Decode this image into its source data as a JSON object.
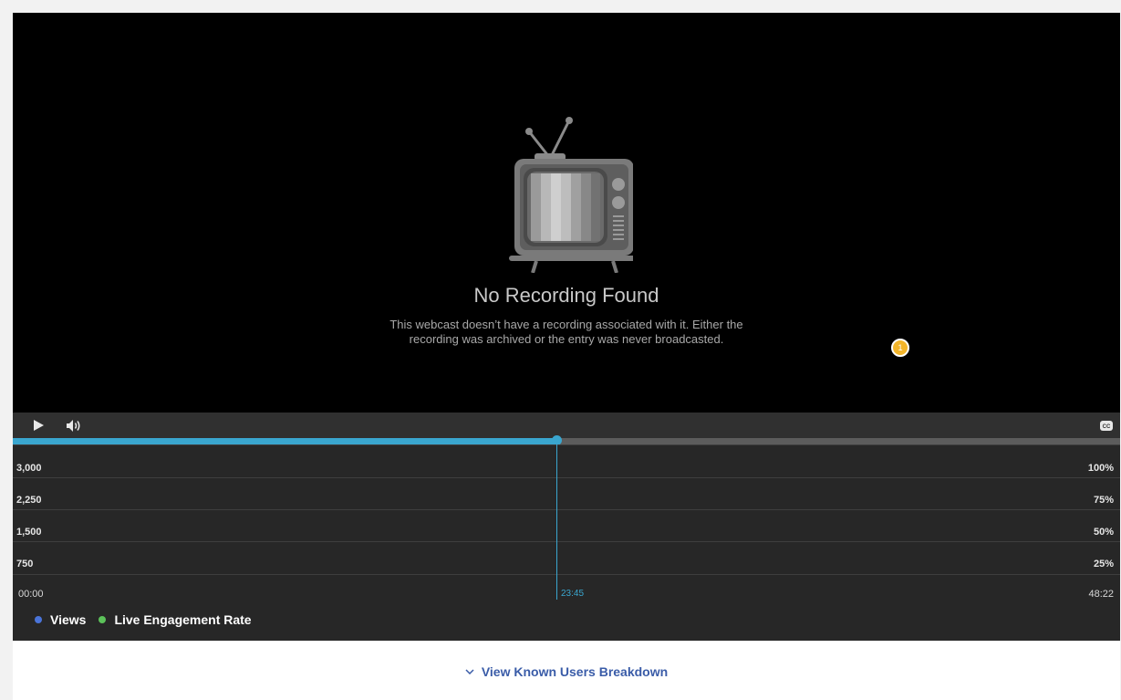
{
  "player": {
    "no_recording_title": "No Recording Found",
    "no_recording_message_line1": "This webcast doesn’t have a recording associated with it. Either the",
    "no_recording_message_line2": "recording was archived or the entry was never broadcasted.",
    "marker_badge": "1",
    "playback_progress": 0.491,
    "icons": {
      "placeholder": "tv-icon",
      "play": "play-icon",
      "volume": "volume-icon",
      "captions": "closed-captions-icon"
    }
  },
  "chart_data": {
    "type": "line",
    "x_range": [
      "00:00",
      "48:22"
    ],
    "current_time": "23:45",
    "y_left_ticks": [
      "3,000",
      "2,250",
      "1,500",
      "750"
    ],
    "y_right_ticks": [
      "100%",
      "75%",
      "50%",
      "25%"
    ],
    "x_tick_start": "00:00",
    "x_tick_end": "48:22",
    "series": [
      {
        "name": "Views",
        "color": "#4a74d9",
        "values": []
      },
      {
        "name": "Live Engagement Rate",
        "color": "#5cc25a",
        "values": []
      }
    ]
  },
  "breakdown": {
    "label": "View Known Users Breakdown"
  },
  "colors": {
    "accent": "#3aa6cf",
    "link": "#3a5ca8",
    "marker": "#f3b52a"
  }
}
